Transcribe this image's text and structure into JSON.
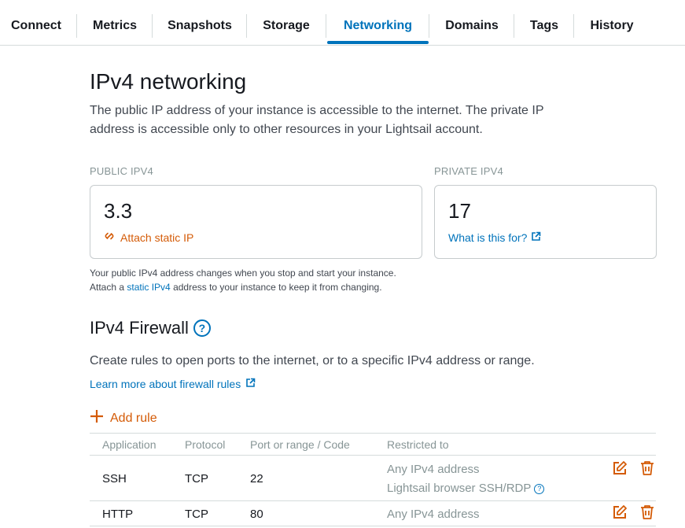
{
  "tabs": [
    {
      "label": "Connect"
    },
    {
      "label": "Metrics"
    },
    {
      "label": "Snapshots"
    },
    {
      "label": "Storage"
    },
    {
      "label": "Networking",
      "active": true
    },
    {
      "label": "Domains"
    },
    {
      "label": "Tags"
    },
    {
      "label": "History"
    }
  ],
  "ipv4": {
    "title": "IPv4 networking",
    "description": "The public IP address of your instance is accessible to the internet. The private IP address is accessible only to other resources in your Lightsail account.",
    "public_label": "PUBLIC IPV4",
    "public_value": "3.3",
    "attach_static_label": "Attach static IP",
    "private_label": "PRIVATE IPV4",
    "private_value": "17",
    "what_is_this_label": "What is this for?",
    "note_line1": "Your public IPv4 address changes when you stop and start your instance.",
    "note_line2_pre": "Attach a ",
    "note_link": "static IPv4",
    "note_line2_post": " address to your instance to keep it from changing."
  },
  "firewall": {
    "title": "IPv4 Firewall",
    "description": "Create rules to open ports to the internet, or to a specific IPv4 address or range.",
    "learn_more": "Learn more about firewall rules",
    "add_rule": "Add rule",
    "columns": [
      "Application",
      "Protocol",
      "Port or range / Code",
      "Restricted to"
    ],
    "rows": [
      {
        "application": "SSH",
        "protocol": "TCP",
        "port": "22",
        "restricted": "Any IPv4 address",
        "restricted2": "Lightsail browser SSH/RDP"
      },
      {
        "application": "HTTP",
        "protocol": "TCP",
        "port": "80",
        "restricted": "Any IPv4 address"
      }
    ]
  },
  "colors": {
    "accent": "#0073bb",
    "orange": "#d45b07"
  }
}
